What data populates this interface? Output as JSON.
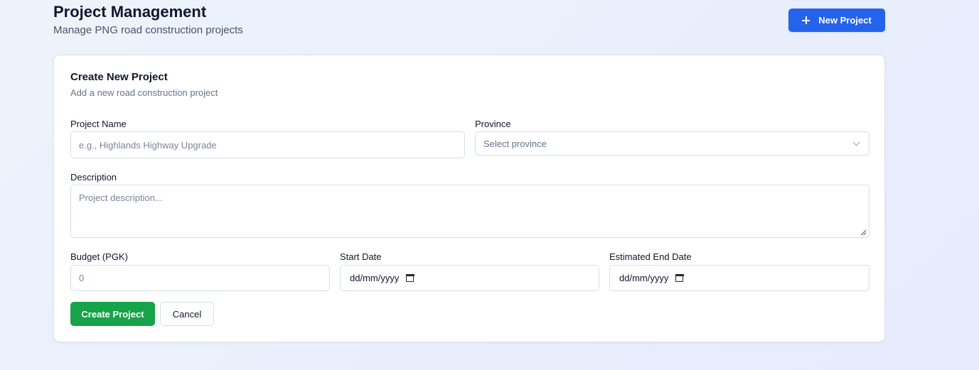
{
  "header": {
    "title": "Project Management",
    "subtitle": "Manage PNG road construction projects",
    "new_project_label": "New Project"
  },
  "form": {
    "title": "Create New Project",
    "subtitle": "Add a new road construction project",
    "project_name": {
      "label": "Project Name",
      "placeholder": "e.g., Highlands Highway Upgrade",
      "value": ""
    },
    "province": {
      "label": "Province",
      "placeholder": "Select province"
    },
    "description": {
      "label": "Description",
      "placeholder": "Project description...",
      "value": ""
    },
    "budget": {
      "label": "Budget (PGK)",
      "placeholder": "0",
      "value": ""
    },
    "start_date": {
      "label": "Start Date",
      "value_display": "dd/mm/yyyy"
    },
    "end_date": {
      "label": "Estimated End Date",
      "value_display": "dd/mm/yyyy"
    },
    "create_label": "Create Project",
    "cancel_label": "Cancel"
  },
  "colors": {
    "primary_button": "#2563eb",
    "create_button": "#16a34a",
    "background": "#eaf0fb"
  },
  "icons": {
    "new_project": "plus-icon",
    "province_select": "chevron-down-icon",
    "description_resize": "resize-handle-icon",
    "date_picker": "calendar-icon"
  }
}
